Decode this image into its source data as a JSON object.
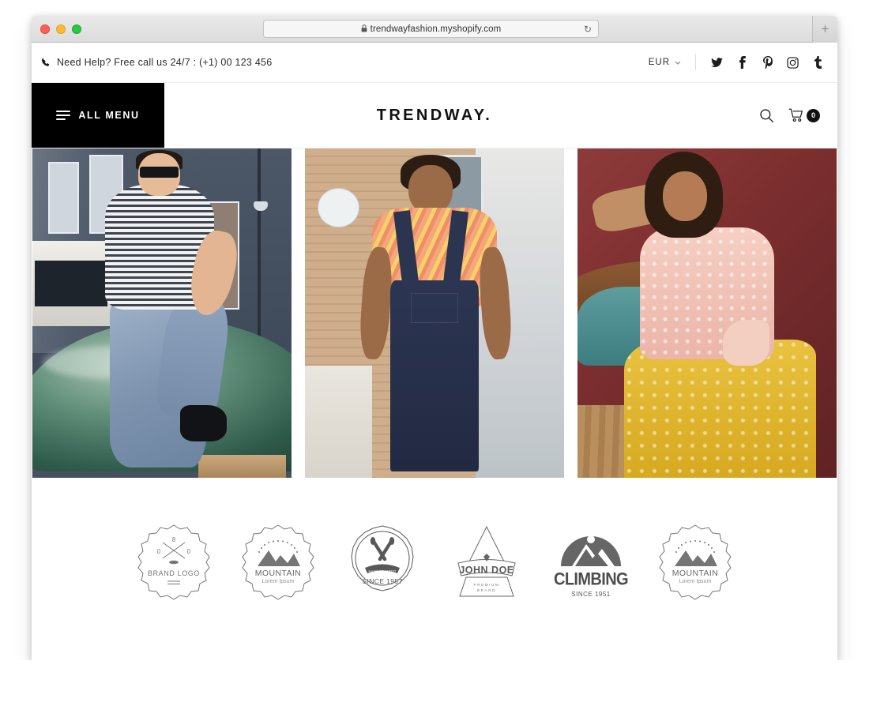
{
  "browser": {
    "url": "trendwayfashion.myshopify.com",
    "lock_icon": "lock-icon",
    "reload_icon": "reload-icon",
    "new_tab_label": "+",
    "traffic_lights": [
      "close",
      "minimize",
      "zoom"
    ]
  },
  "topbar": {
    "phone_icon": "phone-icon",
    "help_text": "Need Help? Free call us 24/7 : (+1) 00 123 456",
    "currency": "EUR",
    "currency_chevron": "⌄",
    "social": [
      {
        "name": "twitter-icon",
        "glyph": "twitter"
      },
      {
        "name": "facebook-icon",
        "glyph": "facebook"
      },
      {
        "name": "pinterest-icon",
        "glyph": "pinterest"
      },
      {
        "name": "instagram-icon",
        "glyph": "instagram"
      },
      {
        "name": "tumblr-icon",
        "glyph": "tumblr"
      }
    ]
  },
  "header": {
    "menu_label": "ALL MENU",
    "logo": "TRENDWAY.",
    "search_icon": "search-icon",
    "cart_icon": "cart-icon",
    "cart_count": "0"
  },
  "hero": {
    "slides": [
      {
        "name": "hero-slide-1",
        "alt": "Man in striped tee sitting on vintage green car"
      },
      {
        "name": "hero-slide-2",
        "alt": "Man in denim overalls and patterned orange tee"
      },
      {
        "name": "hero-slide-3",
        "alt": "Woman in floral dress laughing on red couch"
      }
    ]
  },
  "brands": [
    {
      "name": "brand-logo-badge",
      "title": "BRAND LOGO",
      "subtitle": ""
    },
    {
      "name": "mountain-badge",
      "title": "MOUNTAIN",
      "subtitle": "Lorem Ipsum"
    },
    {
      "name": "since-1957-badge",
      "title": "SINCE 1957",
      "subtitle": "HANDCRAFTED"
    },
    {
      "name": "john-doe-badge",
      "title": "JOHN DOE",
      "subtitle": "PREMIUM BRAND"
    },
    {
      "name": "climbing-badge",
      "title": "CLIMBING",
      "subtitle": "SINCE 1951"
    },
    {
      "name": "mountain-badge-2",
      "title": "MOUNTAIN",
      "subtitle": "Lorem Ipsum"
    }
  ],
  "colors": {
    "accent_black": "#000000",
    "text": "#2b2b2b",
    "logo_gray": "#5a5a5a",
    "page_bg": "#ffffff"
  }
}
